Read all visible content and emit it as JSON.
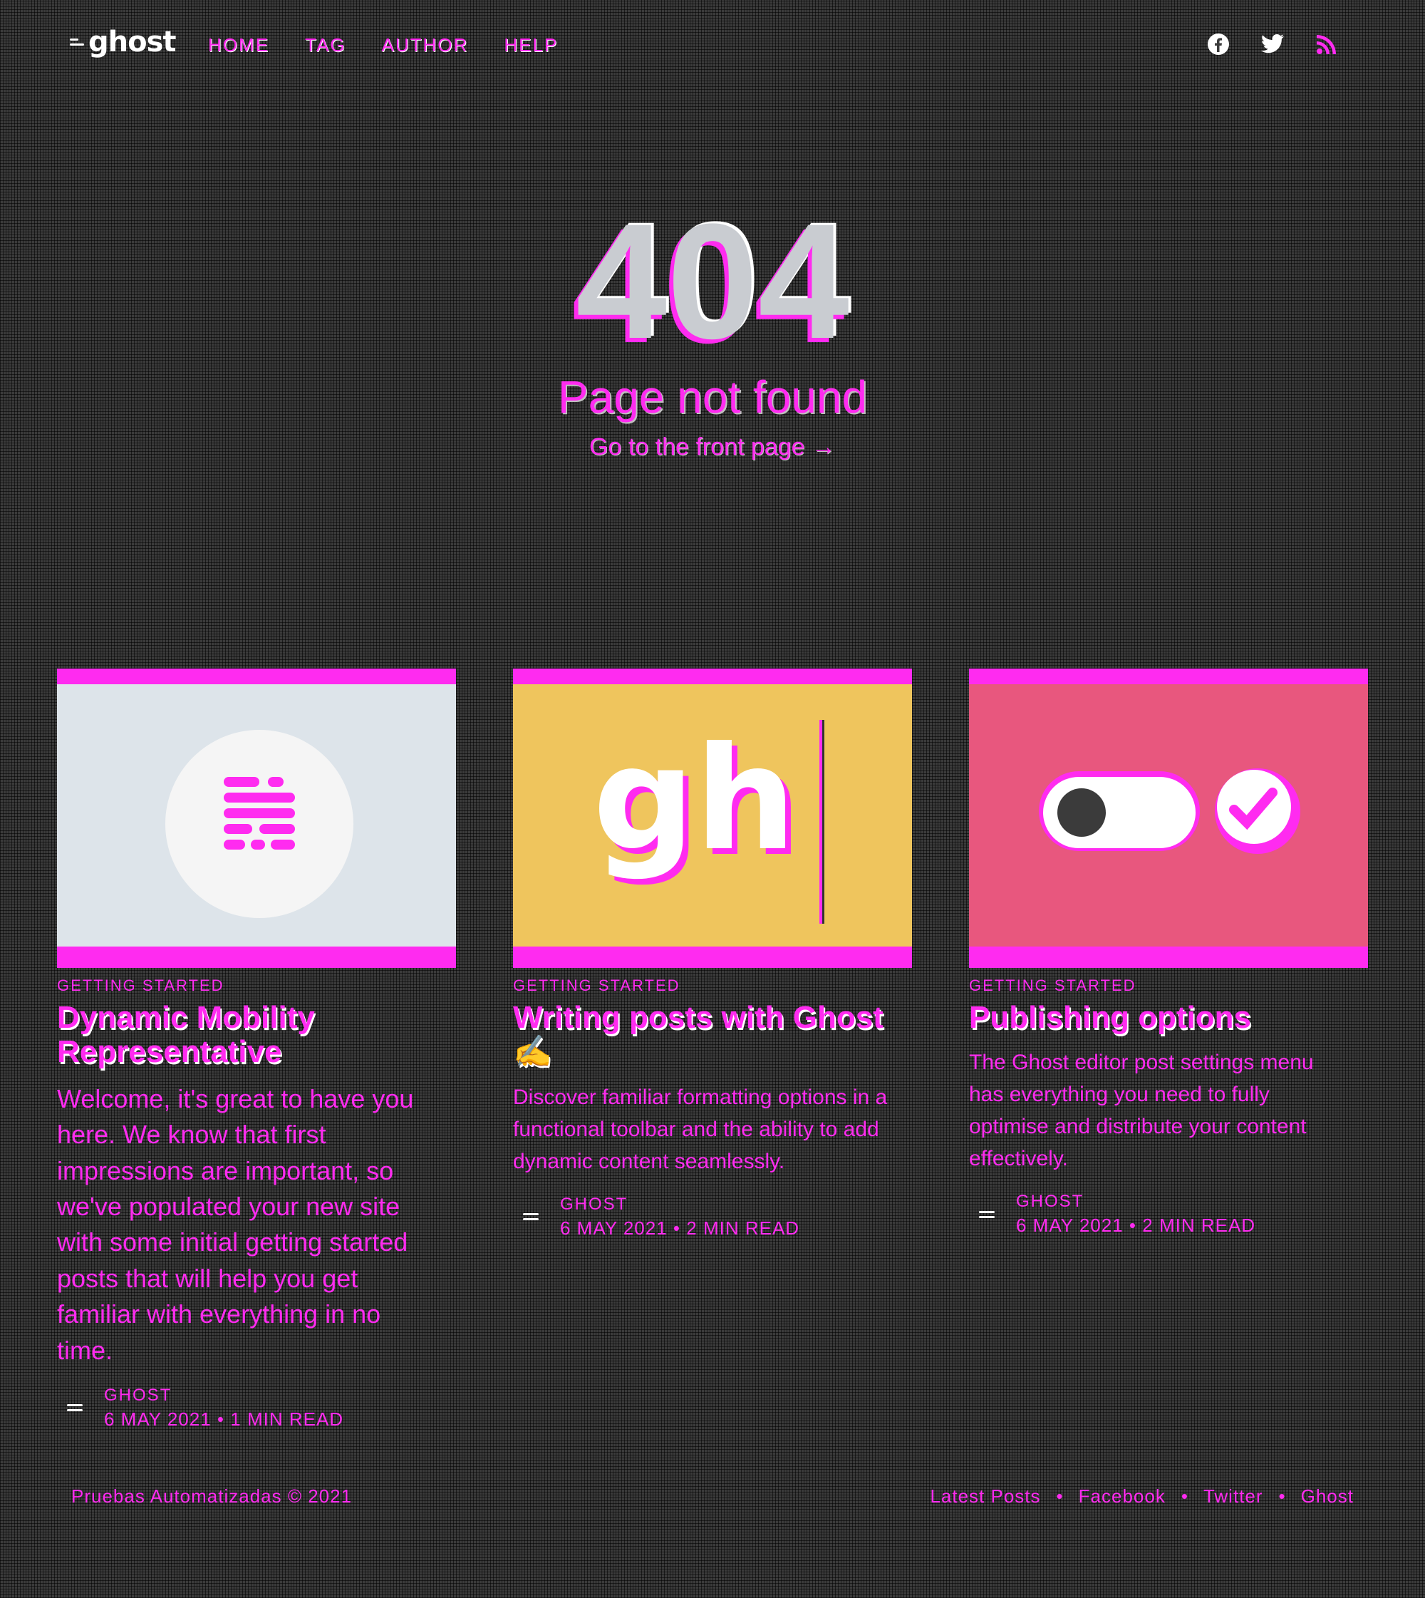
{
  "header": {
    "logo_text": "ghost",
    "nav": [
      "HOME",
      "TAG",
      "AUTHOR",
      "HELP"
    ],
    "social_icons": [
      "facebook-icon",
      "twitter-icon",
      "rss-icon"
    ]
  },
  "error": {
    "code": "404",
    "description": "Page not found",
    "link_text": "Go to the front page →"
  },
  "posts": [
    {
      "tag": "GETTING STARTED",
      "title": "Dynamic Mobility Representative",
      "excerpt": "Welcome, it's great to have you here. We know that first impressions are important, so we've populated your new site with some initial getting started posts that will help you get familiar with everything in no time.",
      "author": "GHOST",
      "date": "6 MAY 2021",
      "reading_time": "1 MIN READ"
    },
    {
      "tag": "GETTING STARTED",
      "title": "Writing posts with Ghost ✍️",
      "excerpt": "Discover familiar formatting options in a functional toolbar and the ability to add dynamic content seamlessly.",
      "author": "GHOST",
      "date": "6 MAY 2021",
      "reading_time": "2 MIN READ"
    },
    {
      "tag": "GETTING STARTED",
      "title": "Publishing options",
      "excerpt": "The Ghost editor post settings menu has everything you need to fully optimise and distribute your content effectively.",
      "author": "GHOST",
      "date": "6 MAY 2021",
      "reading_time": "2 MIN READ"
    }
  ],
  "footer": {
    "copyright": "Pruebas Automatizadas © 2021",
    "links": [
      "Latest Posts",
      "Facebook",
      "Twitter",
      "Ghost"
    ]
  },
  "colors": {
    "background": "#3b3b3b",
    "accent": "#ff2bf0",
    "card1_bg": "#dde4ea",
    "card2_bg": "#efc55d",
    "card3_bg": "#e8577e"
  }
}
